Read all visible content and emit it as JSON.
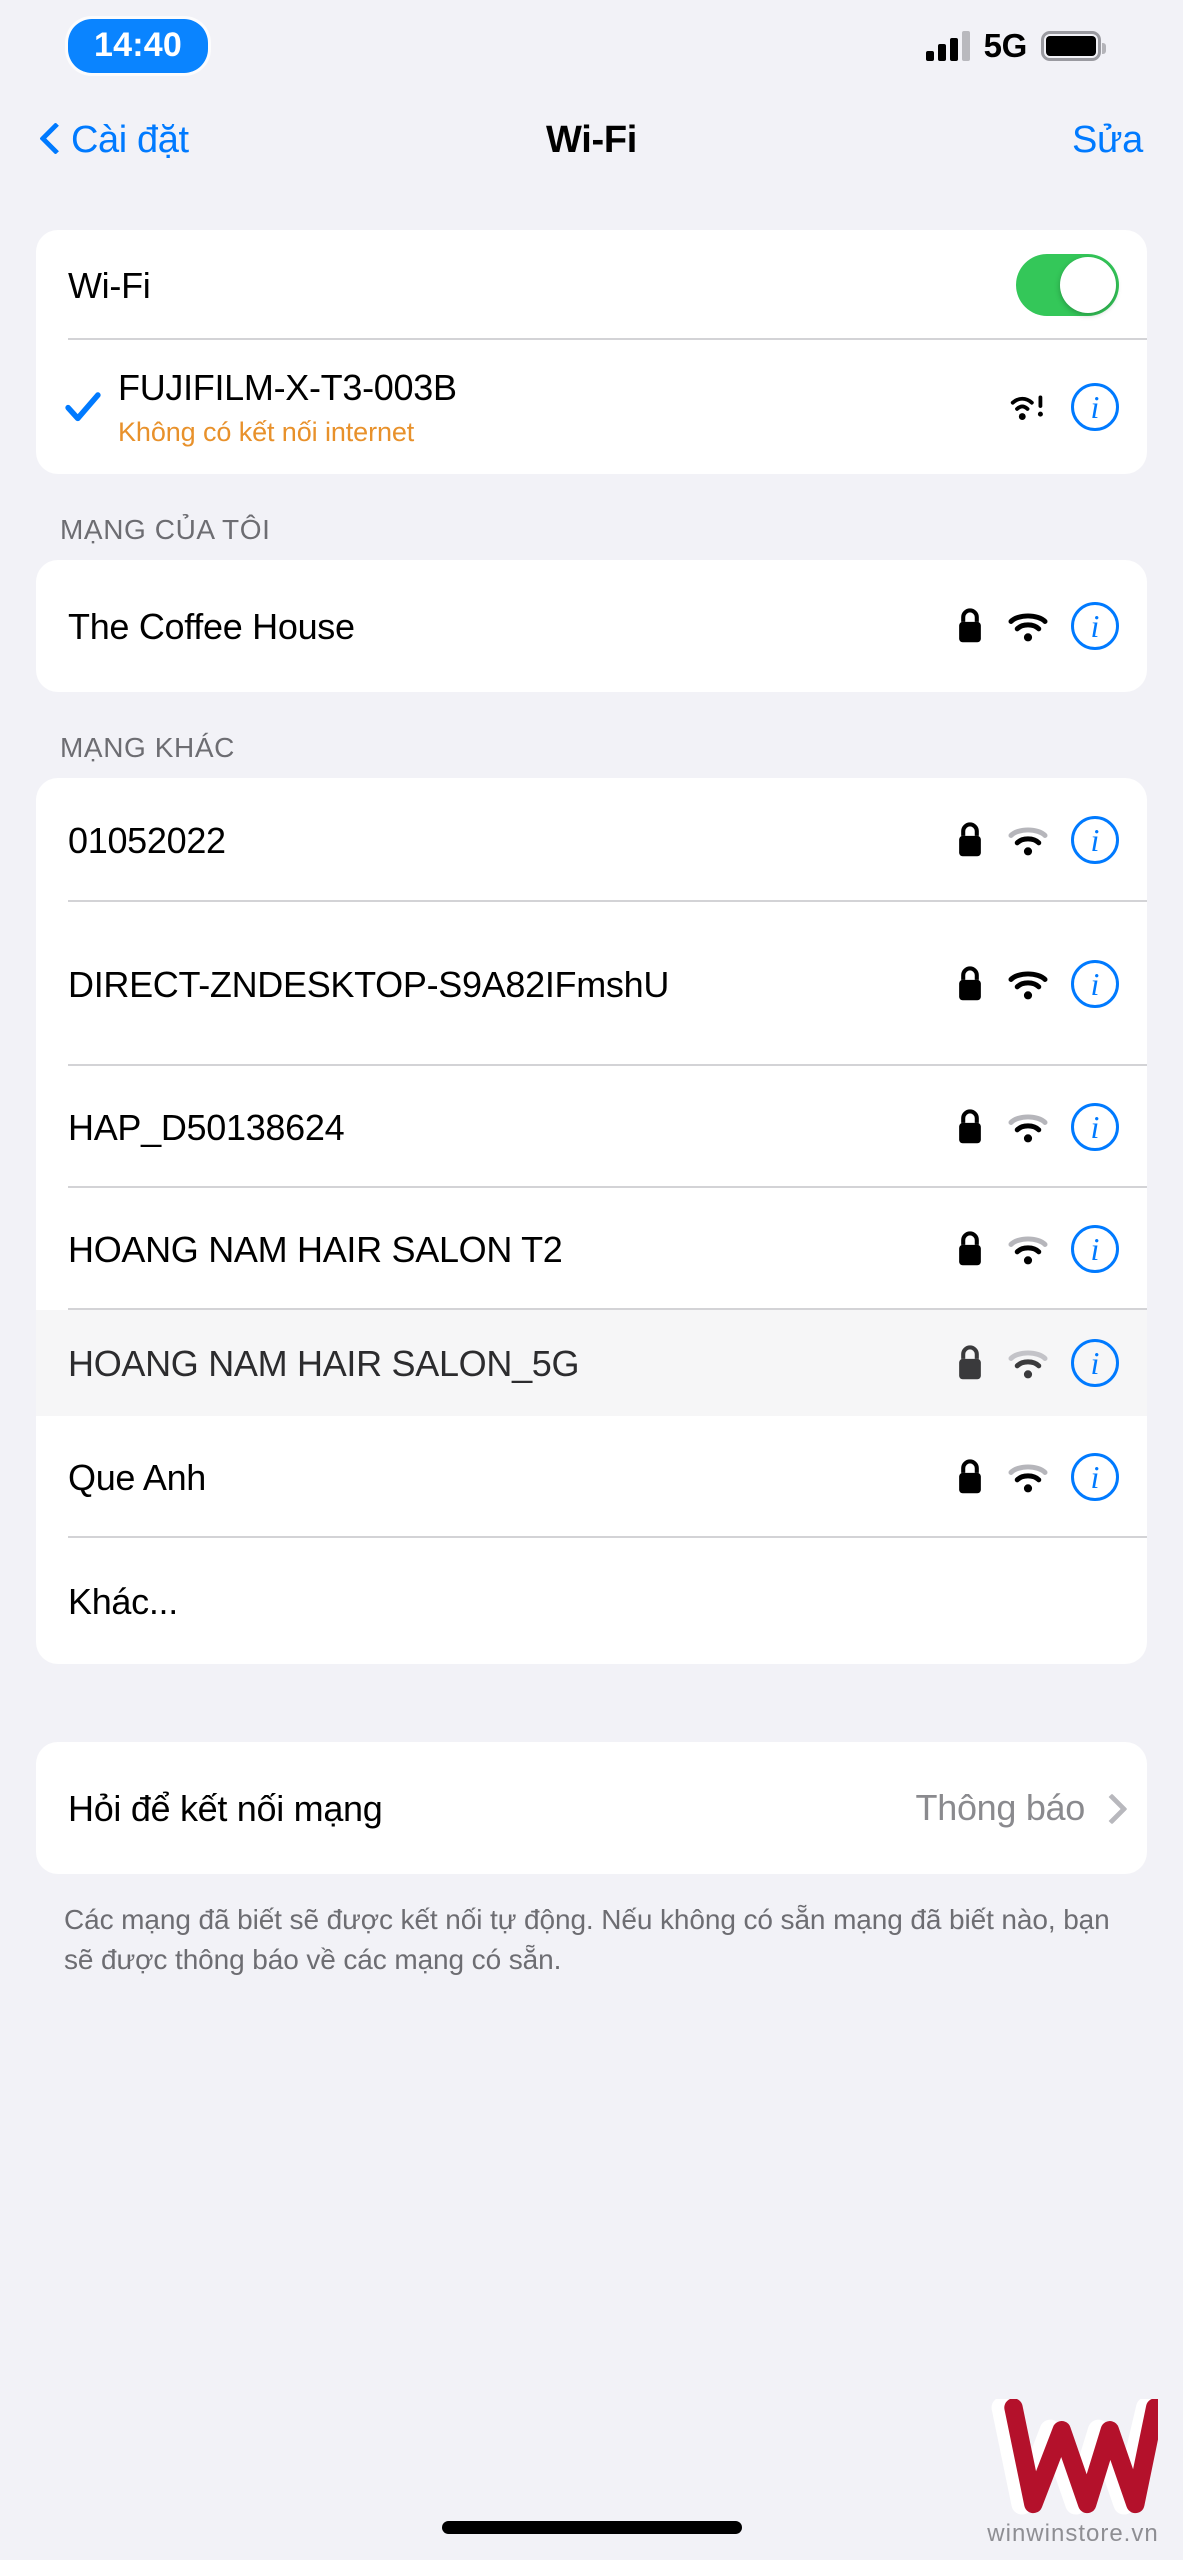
{
  "status_bar": {
    "time": "14:40",
    "network_type": "5G",
    "signal_bars_filled": 3,
    "signal_bars_total": 4,
    "battery_level_percent": 92,
    "time_pill_color": "#0A84FF"
  },
  "nav": {
    "back_label": "Cài đặt",
    "title": "Wi-Fi",
    "edit_label": "Sửa",
    "tint_color": "#007AFF"
  },
  "wifi_toggle": {
    "label": "Wi-Fi",
    "on": true,
    "on_color": "#34C759"
  },
  "connected_network": {
    "name": "FUJIFILM-X-T3-003B",
    "subtitle": "Không có kết nối internet",
    "subtitle_color": "#E8912B",
    "checked": true,
    "signal_icon": "wifi-exclamation-icon",
    "info_label": "i"
  },
  "sections": [
    {
      "header": "MẠNG CỦA TÔI",
      "networks": [
        {
          "name": "The Coffee House",
          "secured": true,
          "signal_strength": 3,
          "pressed": false
        }
      ]
    },
    {
      "header": "MẠNG KHÁC",
      "networks": [
        {
          "name": "01052022",
          "secured": true,
          "signal_strength": 2,
          "pressed": false
        },
        {
          "name": "DIRECT-ZNDESKTOP-S9A82IFmshU",
          "secured": true,
          "signal_strength": 3,
          "pressed": false
        },
        {
          "name": "HAP_D50138624",
          "secured": true,
          "signal_strength": 2,
          "pressed": false
        },
        {
          "name": "HOANG NAM HAIR SALON T2",
          "secured": true,
          "signal_strength": 2,
          "pressed": false
        },
        {
          "name": "HOANG NAM HAIR SALON_5G",
          "secured": true,
          "signal_strength": 2,
          "pressed": true
        },
        {
          "name": "Que Anh",
          "secured": true,
          "signal_strength": 2,
          "pressed": false
        }
      ],
      "other_label": "Khác..."
    }
  ],
  "ask_to_join": {
    "label": "Hỏi để kết nối mạng",
    "value": "Thông báo"
  },
  "footer": "Các mạng đã biết sẽ được kết nối tự động. Nếu không có sẵn mạng đã biết nào, bạn sẽ được thông báo về các mạng có sẵn.",
  "watermark": {
    "logo_letter": "W",
    "site": "winwinstore.vn",
    "color": "#B4112B"
  }
}
